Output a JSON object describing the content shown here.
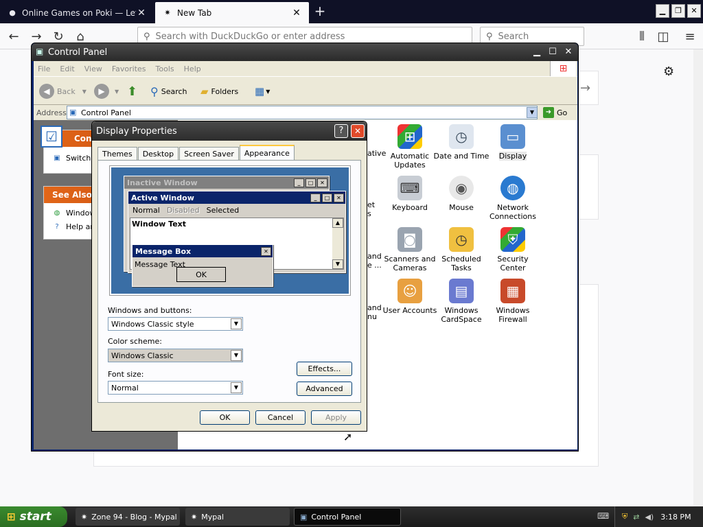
{
  "browser": {
    "tabs": [
      {
        "label": "Online Games on Poki — Let's play",
        "icon": "poki-favicon-icon"
      },
      {
        "label": "New Tab",
        "icon": "firefox-tab-icon"
      }
    ],
    "url_placeholder": "Search with DuckDuckGo or enter address",
    "search_placeholder": "Search"
  },
  "control_panel": {
    "title": "Control Panel",
    "menu": [
      "File",
      "Edit",
      "View",
      "Favorites",
      "Tools",
      "Help"
    ],
    "toolbar": {
      "back": "Back",
      "search": "Search",
      "folders": "Folders"
    },
    "address_label": "Address",
    "address_value": "Control Panel",
    "go": "Go",
    "left_pane": {
      "header1": "Contro",
      "link1": "Switch t",
      "header2": "See Also",
      "link2": "Window",
      "link3": "Help an"
    },
    "partial_labels": [
      "ative",
      "et",
      "s",
      "and",
      "e ...",
      "and",
      "nu"
    ],
    "icons": [
      {
        "label": "Automatic Updates"
      },
      {
        "label": "Date and Time"
      },
      {
        "label": "Display"
      },
      {
        "label": "Keyboard"
      },
      {
        "label": "Mouse"
      },
      {
        "label": "Network Connections"
      },
      {
        "label": "Scanners and Cameras"
      },
      {
        "label": "Scheduled Tasks"
      },
      {
        "label": "Security Center"
      },
      {
        "label": "User Accounts"
      },
      {
        "label": "Windows CardSpace"
      },
      {
        "label": "Windows Firewall"
      }
    ]
  },
  "display_properties": {
    "title": "Display Properties",
    "tabs": [
      "Themes",
      "Desktop",
      "Screen Saver",
      "Appearance"
    ],
    "active_tab": "Appearance",
    "preview": {
      "inactive_title": "Inactive Window",
      "active_title": "Active Window",
      "menu_normal": "Normal",
      "menu_disabled": "Disabled",
      "menu_selected": "Selected",
      "window_text": "Window Text",
      "msgbox_title": "Message Box",
      "msgbox_text": "Message Text",
      "ok": "OK"
    },
    "windows_buttons_label": "Windows and buttons:",
    "windows_buttons_value": "Windows Classic style",
    "color_scheme_label": "Color scheme:",
    "color_scheme_value": "Windows Classic",
    "font_size_label": "Font size:",
    "font_size_value": "Normal",
    "effects": "Effects...",
    "advanced": "Advanced",
    "ok": "OK",
    "cancel": "Cancel",
    "apply": "Apply"
  },
  "taskbar": {
    "start": "start",
    "tasks": [
      "Zone 94 - Blog - Mypal",
      "Mypal",
      "Control Panel"
    ],
    "time": "3:18 PM"
  }
}
